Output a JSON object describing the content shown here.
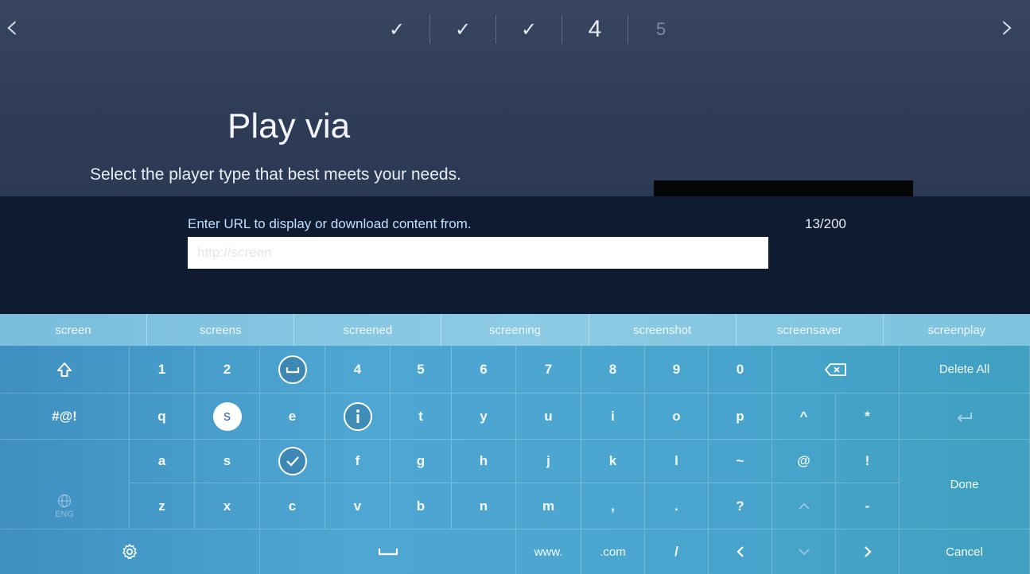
{
  "wizard": {
    "steps": [
      "✓",
      "✓",
      "✓",
      "4",
      "5"
    ],
    "prev_icon": "chevron-left-icon",
    "next_icon": "chevron-right-icon"
  },
  "header": {
    "title": "Play via",
    "subtitle": "Select the player type that best meets your needs."
  },
  "url_panel": {
    "label": "Enter URL to display or download content from.",
    "counter": "13/200",
    "value": "http://screen"
  },
  "suggestions": [
    "screen",
    "screens",
    "screened",
    "screening",
    "screenshot",
    "screensaver",
    "screenplay"
  ],
  "keyboard": {
    "row1": [
      "1",
      "2",
      "",
      "4",
      "5",
      "6",
      "7",
      "8",
      "9",
      "0"
    ],
    "row2": [
      "q",
      "s",
      "e",
      "",
      "t",
      "y",
      "u",
      "i",
      "o",
      "p",
      "^",
      "*"
    ],
    "row3": [
      "a",
      "s",
      "",
      "f",
      "g",
      "h",
      "j",
      "k",
      "l",
      "~",
      "@",
      "!"
    ],
    "row4": [
      "z",
      "x",
      "c",
      "v",
      "b",
      "n",
      "m",
      ",",
      ".",
      "?",
      "",
      "-"
    ],
    "symbols_label": "#@!",
    "delete_all_label": "Delete All",
    "done_label": "Done",
    "cancel_label": "Cancel",
    "www_label": "www.",
    "com_label": ".com",
    "slash_label": "/",
    "lang_label": "ENG"
  }
}
